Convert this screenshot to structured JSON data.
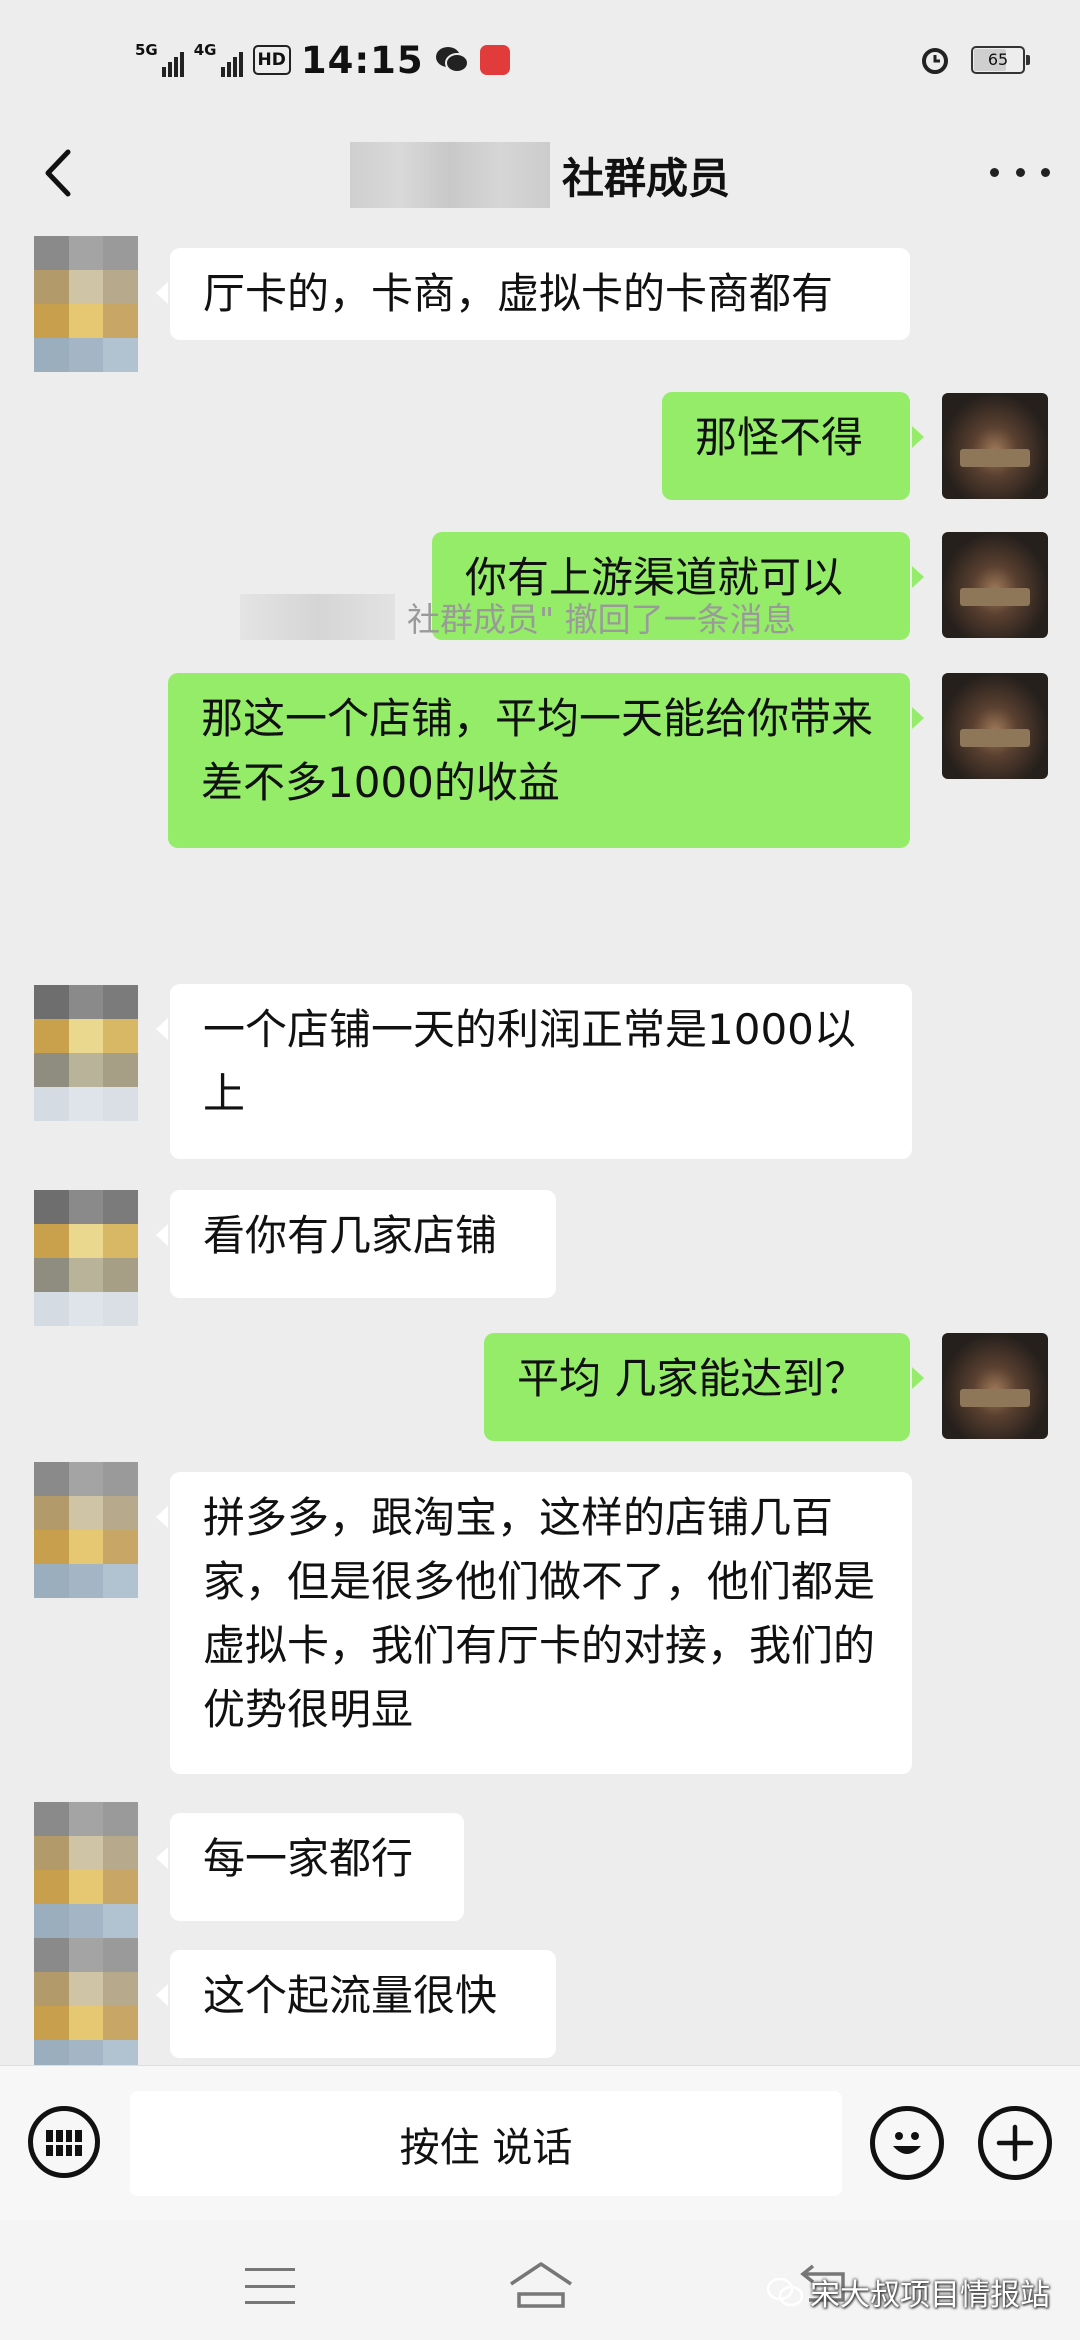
{
  "status_bar": {
    "network1": "5G",
    "network2": "4G",
    "hd": "HD",
    "time": "14:15",
    "battery": "65"
  },
  "nav": {
    "title": "社群成员"
  },
  "messages": [
    {
      "side": "in",
      "text": "厅卡的，卡商，虚拟卡的卡商都有"
    },
    {
      "side": "out",
      "text": "那怪不得"
    },
    {
      "side": "out",
      "text": "你有上游渠道就可以"
    },
    {
      "side": "out",
      "text": "那这一个店铺，平均一天能给你带来差不多1000的收益"
    },
    {
      "side": "system",
      "text": "社群成员\" 撤回了一条消息"
    },
    {
      "side": "in",
      "text": "一个店铺一天的利润正常是1000以上"
    },
    {
      "side": "in",
      "text": "看你有几家店铺"
    },
    {
      "side": "out",
      "text": "平均 几家能达到？"
    },
    {
      "side": "in",
      "text": "拼多多，跟淘宝，这样的店铺几百家，但是很多他们做不了，他们都是虚拟卡，我们有厅卡的对接，我们的优势很明显"
    },
    {
      "side": "in",
      "text": "每一家都行"
    },
    {
      "side": "in",
      "text": "这个起流量很快"
    }
  ],
  "input_bar": {
    "voice_label": "按住 说话"
  },
  "watermark": {
    "text": "宋大叔项目情报站"
  },
  "colors": {
    "background": "#ededed",
    "outgoing_bubble": "#95ec69",
    "incoming_bubble": "#ffffff",
    "system_text": "#9a9a9a"
  },
  "icons": [
    "back-arrow-icon",
    "more-icon",
    "keyboard-icon",
    "emoji-icon",
    "plus-icon",
    "menu-icon",
    "home-icon",
    "back-nav-icon",
    "wechat-icon",
    "alarm-icon"
  ]
}
